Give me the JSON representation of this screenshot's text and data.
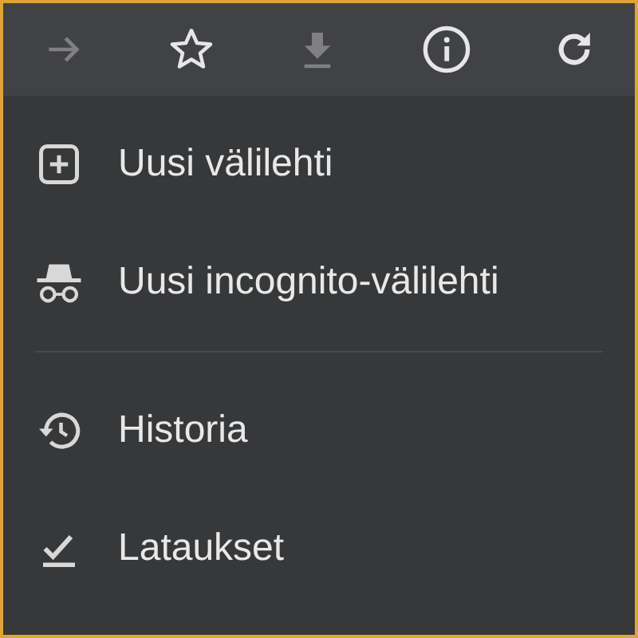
{
  "toolbar": {
    "buttons": [
      {
        "kind": "forward",
        "disabled": true
      },
      {
        "kind": "bookmark",
        "disabled": false
      },
      {
        "kind": "download",
        "disabled": true
      },
      {
        "kind": "info",
        "disabled": false
      },
      {
        "kind": "reload",
        "disabled": false
      }
    ]
  },
  "menu": {
    "sections": [
      [
        {
          "kind": "new-tab",
          "label": "Uusi välilehti"
        },
        {
          "kind": "incognito",
          "label": "Uusi incognito-välilehti"
        }
      ],
      [
        {
          "kind": "history",
          "label": "Historia"
        },
        {
          "kind": "downloads",
          "label": "Lataukset"
        }
      ]
    ]
  }
}
